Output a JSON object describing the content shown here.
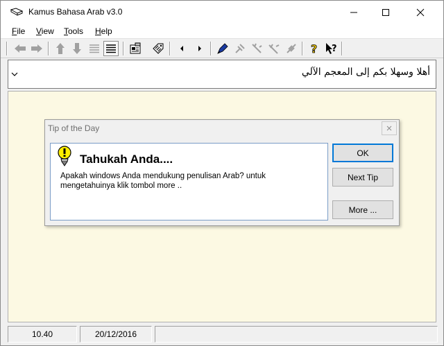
{
  "window": {
    "title": "Kamus Bahasa Arab v3.0",
    "app_icon": "app-book-icon"
  },
  "menu": [
    {
      "label": "File",
      "accel": "F",
      "rest": "ile"
    },
    {
      "label": "View",
      "accel": "V",
      "rest": "iew"
    },
    {
      "label": "Tools",
      "accel": "T",
      "rest": "ools"
    },
    {
      "label": "Help",
      "accel": "H",
      "rest": "elp"
    }
  ],
  "toolbar": {
    "icons": [
      "arrow-left-icon",
      "arrow-right-icon",
      "arrow-up-icon",
      "arrow-down-icon",
      "lines-light-icon",
      "lines-dark-icon",
      "properties-icon",
      "tag-icon",
      "triangle-left-icon",
      "triangle-right-icon",
      "pen-icon",
      "tools-1-icon",
      "tools-2-icon",
      "tools-3-icon",
      "tools-4-icon",
      "help-icon",
      "context-help-icon"
    ]
  },
  "combo": {
    "value": "أهلا وسهلا بكم إلى المعجم الآلي"
  },
  "dialog": {
    "title": "Tip of the Day",
    "heading": "Tahukah Anda....",
    "body": "Apakah windows Anda mendukung penulisan Arab? untuk mengetahuinya klik tombol more ..",
    "buttons": {
      "ok": "OK",
      "next": "Next Tip",
      "more": "More ..."
    }
  },
  "status": {
    "version": "10.40",
    "date": "20/12/2016"
  },
  "colors": {
    "main_bg": "#fcf9e3",
    "dialog_border": "#7a9cc6",
    "default_button_border": "#0078d7"
  }
}
